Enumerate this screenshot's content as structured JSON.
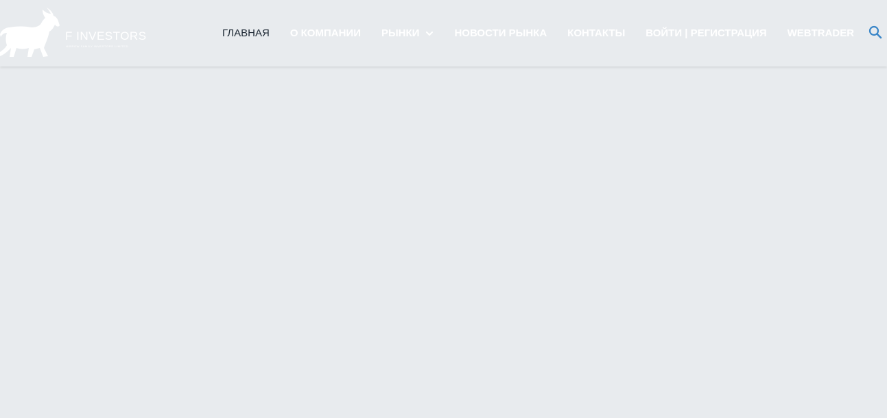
{
  "brand": {
    "name": "F INVESTORS",
    "tagline": "HIBROW FAMILY INVESTORS LIMITED"
  },
  "nav": {
    "items": [
      {
        "label": "ГЛАВНАЯ",
        "active": true
      },
      {
        "label": "О КОМПАНИИ"
      },
      {
        "label": "РЫНКИ",
        "has_dropdown": true
      },
      {
        "label": "НОВОСТИ РЫНКА"
      },
      {
        "label": "КОНТАКТЫ"
      },
      {
        "label": "ВОЙТИ | РЕГИСТРАЦИЯ"
      },
      {
        "label": "WEBTRADER"
      }
    ]
  },
  "icons": {
    "logo": "bull-icon",
    "dropdown": "chevron-down-icon",
    "search": "search-icon"
  },
  "colors": {
    "background": "#e8ebee",
    "nav_text": "#ffffff",
    "nav_active": "#1c2733",
    "search_icon": "#3a86c8"
  }
}
